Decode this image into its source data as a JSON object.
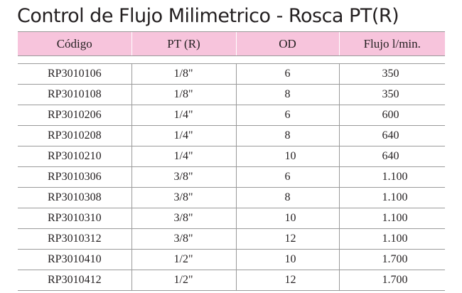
{
  "title": "Control de Flujo Milimetrico - Rosca PT(R)",
  "table": {
    "headers": [
      "Código",
      "PT (R)",
      "OD",
      "Flujo l/min."
    ],
    "rows": [
      [
        "RP3010106",
        "1/8\"",
        "6",
        "350"
      ],
      [
        "RP3010108",
        "1/8\"",
        "8",
        "350"
      ],
      [
        "RP3010206",
        "1/4\"",
        "6",
        "600"
      ],
      [
        "RP3010208",
        "1/4\"",
        "8",
        "640"
      ],
      [
        "RP3010210",
        "1/4\"",
        "10",
        "640"
      ],
      [
        "RP3010306",
        "3/8\"",
        "6",
        "1.100"
      ],
      [
        "RP3010308",
        "3/8\"",
        "8",
        "1.100"
      ],
      [
        "RP3010310",
        "3/8\"",
        "10",
        "1.100"
      ],
      [
        "RP3010312",
        "3/8\"",
        "12",
        "1.100"
      ],
      [
        "RP3010410",
        "1/2\"",
        "10",
        "1.700"
      ],
      [
        "RP3010412",
        "1/2\"",
        "12",
        "1.700"
      ]
    ]
  },
  "colors": {
    "header_background": "#f7c4dc",
    "text": "#231f20",
    "rule": "#9a9a9a"
  }
}
